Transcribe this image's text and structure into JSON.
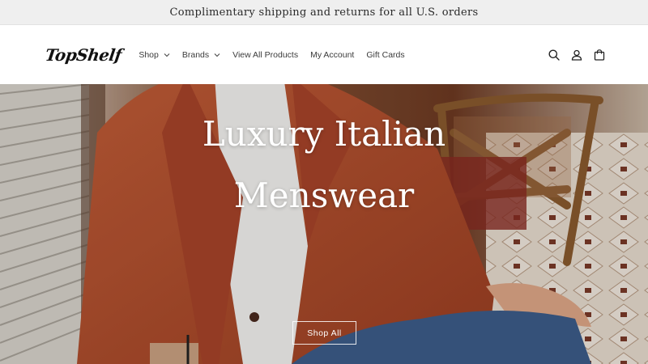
{
  "announcement": {
    "text": "Complimentary shipping and returns for all U.S. orders"
  },
  "header": {
    "logo": "TopShelf",
    "nav": [
      {
        "label": "Shop",
        "has_dropdown": true
      },
      {
        "label": "Brands",
        "has_dropdown": true
      },
      {
        "label": "View All Products",
        "has_dropdown": false
      },
      {
        "label": "My Account",
        "has_dropdown": false
      },
      {
        "label": "Gift Cards",
        "has_dropdown": false
      }
    ],
    "icons": [
      "search-icon",
      "account-icon",
      "cart-icon"
    ]
  },
  "hero": {
    "title_line1": "Luxury Italian",
    "title_line2": "Menswear",
    "cta_label": "Shop All"
  },
  "colors": {
    "announcement_bg": "#efefef",
    "jacket": "#b5502e",
    "text_dark": "#222222"
  }
}
